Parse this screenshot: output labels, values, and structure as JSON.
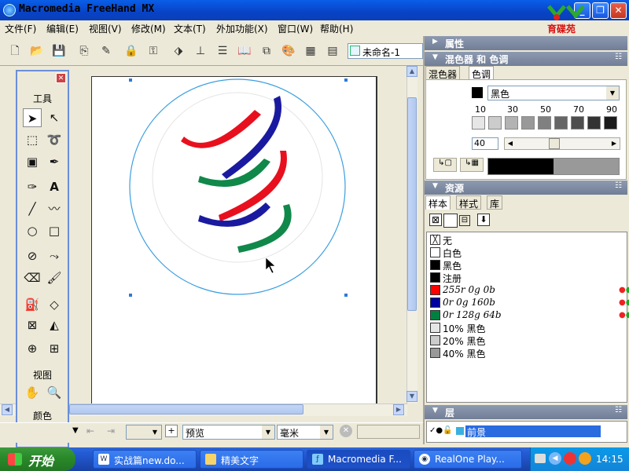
{
  "window": {
    "title": "Macromedia FreeHand MX",
    "logo_text": "育碟苑"
  },
  "menu": [
    "文件(F)",
    "编辑(E)",
    "视图(V)",
    "修改(M)",
    "文本(T)",
    "外加功能(X)",
    "窗口(W)",
    "帮助(H)"
  ],
  "toolbar": {
    "document_name": "未命名-1"
  },
  "tools_panel": {
    "title": "工具",
    "view_label": "视图",
    "color_label": "颜色"
  },
  "right_panel": {
    "properties_title": "属性",
    "mixer_title": "混色器 和 色调",
    "mixer_tab": "混色器",
    "tint_tab": "色调",
    "tint_color_name": "黑色",
    "tint_steps": [
      "10",
      "30",
      "50",
      "70",
      "90"
    ],
    "tint_value": "40",
    "assets_title": "资源",
    "assets_tabs": [
      "样本",
      "样式",
      "库"
    ],
    "swatches": [
      {
        "name": "无",
        "color": "none",
        "italic": false
      },
      {
        "name": "白色",
        "color": "#ffffff",
        "italic": false
      },
      {
        "name": "黑色",
        "color": "#000000",
        "italic": false
      },
      {
        "name": "注册",
        "color": "#000000",
        "italic": false
      },
      {
        "name": "255r 0g 0b",
        "color": "#ff0000",
        "italic": true
      },
      {
        "name": "0r 0g 160b",
        "color": "#0000a0",
        "italic": true
      },
      {
        "name": "0r 128g 64b",
        "color": "#008040",
        "italic": true
      },
      {
        "name": "10% 黑色",
        "color": "#e6e6e6",
        "italic": false
      },
      {
        "name": "20% 黑色",
        "color": "#cccccc",
        "italic": false
      },
      {
        "name": "40% 黑色",
        "color": "#999999",
        "italic": false
      }
    ],
    "layers_title": "层",
    "layer_name": "前景"
  },
  "statusbar": {
    "view_mode": "预览",
    "units": "毫米"
  },
  "taskbar": {
    "start_label": "开始",
    "tasks": [
      "实战篇new.do...",
      "精美文字",
      "Macromedia F...",
      "RealOne Play..."
    ],
    "clock": "14:15"
  },
  "colors": {
    "wto_red": "#e8101e",
    "wto_blue": "#1a1aa0",
    "wto_green": "#10884a"
  }
}
